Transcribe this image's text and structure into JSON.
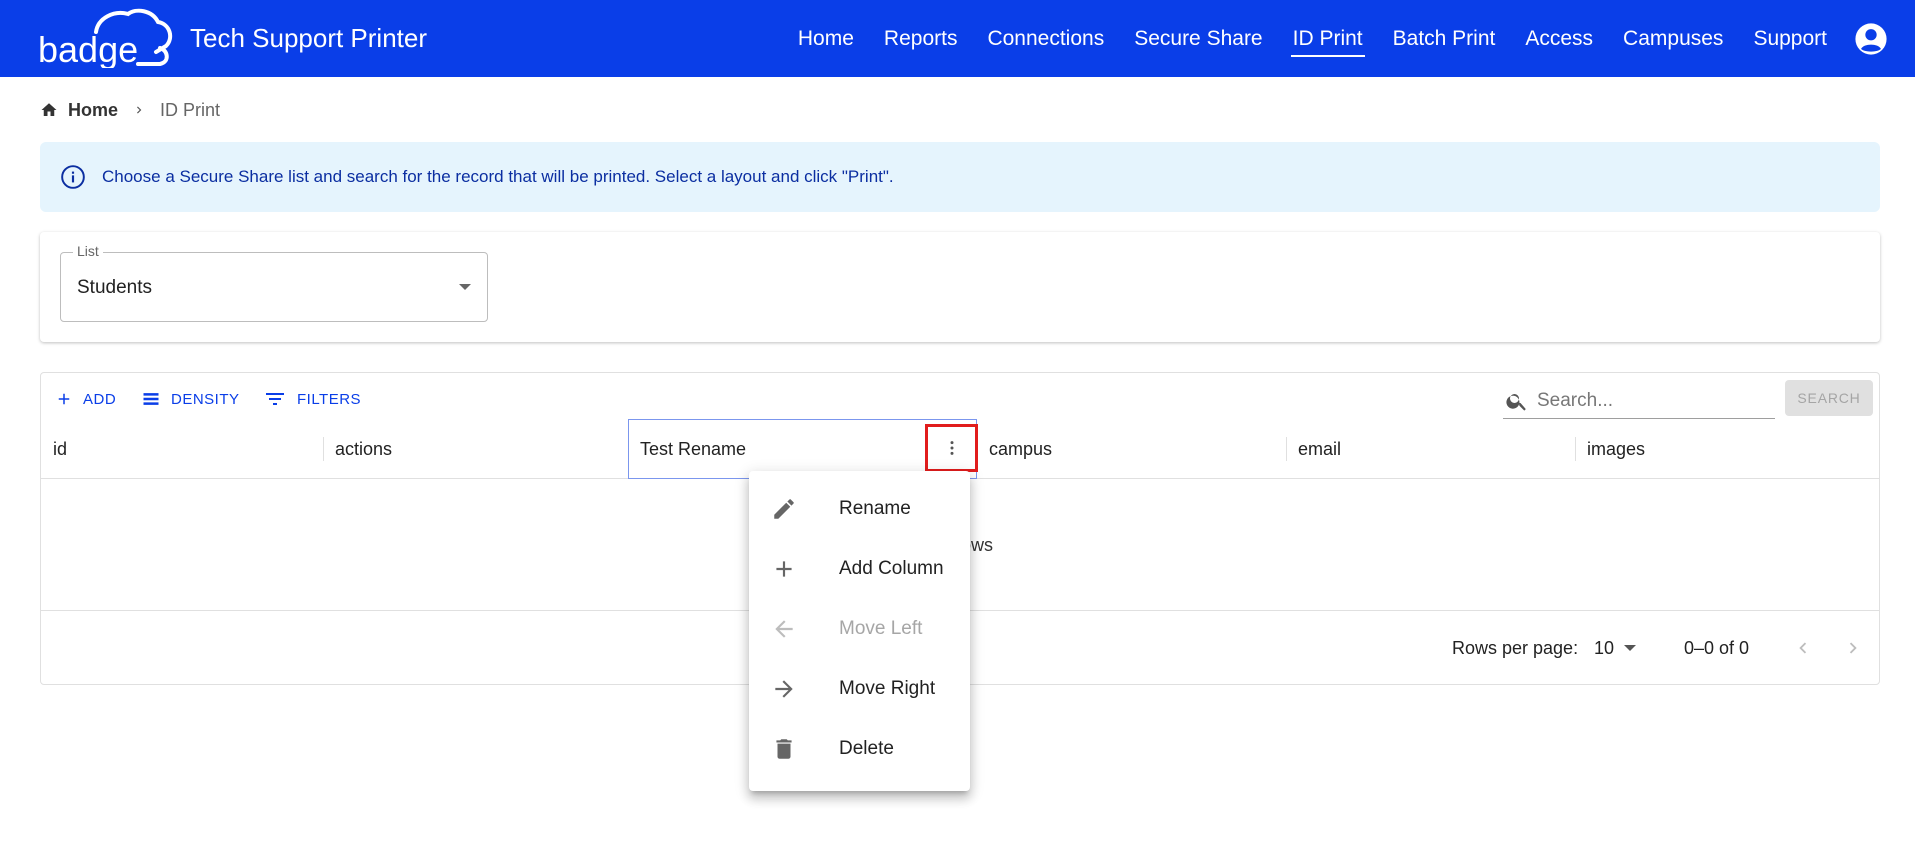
{
  "header": {
    "logo_text": "badge",
    "app_title": "Tech Support Printer",
    "nav": [
      {
        "label": "Home",
        "active": false
      },
      {
        "label": "Reports",
        "active": false
      },
      {
        "label": "Connections",
        "active": false
      },
      {
        "label": "Secure Share",
        "active": false
      },
      {
        "label": "ID Print",
        "active": true
      },
      {
        "label": "Batch Print",
        "active": false
      },
      {
        "label": "Access",
        "active": false
      },
      {
        "label": "Campuses",
        "active": false
      },
      {
        "label": "Support",
        "active": false
      }
    ],
    "account_icon": "account-circle-icon",
    "colors": {
      "bar": "#0a3ee8",
      "text": "#ffffff"
    }
  },
  "breadcrumb": {
    "home": "Home",
    "current": "ID Print"
  },
  "alert": {
    "text": "Choose a Secure Share list and search for the record that will be printed. Select a layout and click \"Print\".",
    "icon": "info-icon",
    "colors": {
      "background": "#e5f4fd",
      "text": "#0b2ea1"
    }
  },
  "list_select": {
    "label": "List",
    "value": "Students"
  },
  "grid": {
    "toolbar": {
      "add": "ADD",
      "density": "DENSITY",
      "filters": "FILTERS",
      "search_placeholder": "Search...",
      "search_button": "SEARCH"
    },
    "columns": [
      "id",
      "actions",
      "Test Rename",
      "campus",
      "email",
      "images"
    ],
    "empty_text": "No rows",
    "footer": {
      "rows_per_page_label": "Rows per page:",
      "rows_per_page_value": "10",
      "page_info": "0–0 of 0"
    }
  },
  "column_menu": {
    "items": [
      {
        "label": "Rename",
        "icon": "pencil-icon",
        "disabled": false
      },
      {
        "label": "Add Column",
        "icon": "plus-icon",
        "disabled": false
      },
      {
        "label": "Move Left",
        "icon": "arrow-left-icon",
        "disabled": true
      },
      {
        "label": "Move Right",
        "icon": "arrow-right-icon",
        "disabled": false
      },
      {
        "label": "Delete",
        "icon": "trash-icon",
        "disabled": false
      }
    ]
  },
  "highlight_color": "#e11d1d"
}
